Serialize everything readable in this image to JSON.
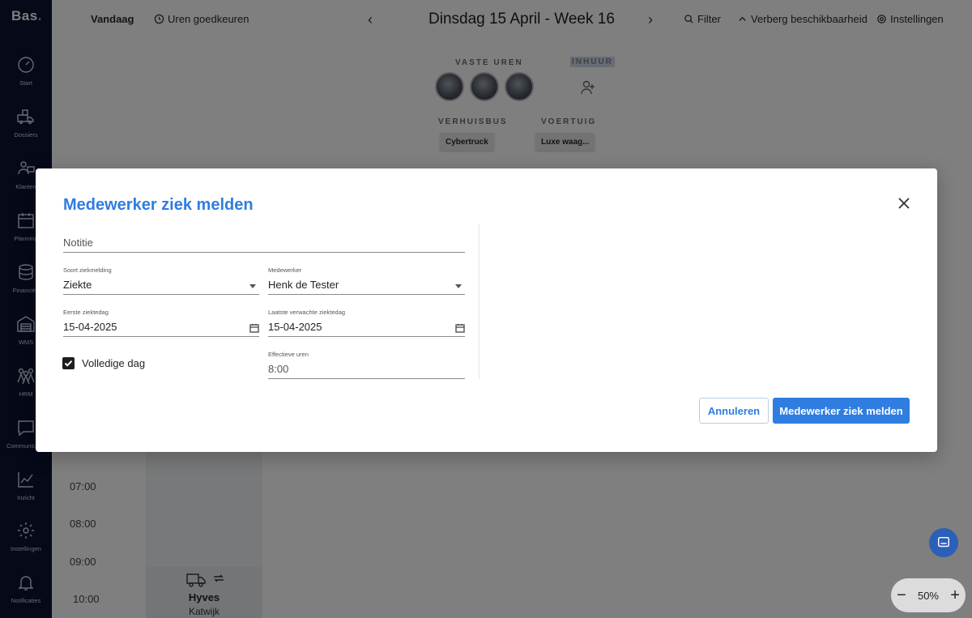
{
  "sidebar": {
    "logo": "Bas",
    "items": [
      {
        "label": "Start",
        "icon": "dashboard-icon"
      },
      {
        "label": "Dossiers",
        "icon": "truck-boxes-icon"
      },
      {
        "label": "Klanten",
        "icon": "customers-icon"
      },
      {
        "label": "Planning",
        "icon": "calendar-icon"
      },
      {
        "label": "Financiën",
        "icon": "coins-icon"
      },
      {
        "label": "WMS",
        "icon": "warehouse-icon"
      },
      {
        "label": "HRM",
        "icon": "people-icon"
      },
      {
        "label": "Communicatie",
        "icon": "chat-icon"
      },
      {
        "label": "Inzicht",
        "icon": "chart-icon"
      },
      {
        "label": "Instellingen",
        "icon": "gear-icon"
      },
      {
        "label": "Notificaties",
        "icon": "bell-icon"
      }
    ]
  },
  "topbar": {
    "today": "Vandaag",
    "approve_hours": "Uren goedkeuren",
    "date_title": "Dinsdag 15 April - Week 16",
    "filter": "Filter",
    "hide_availability": "Verberg beschikbaarheid",
    "settings": "Instellingen"
  },
  "planning": {
    "fixed_hours_label": "VASTE UREN",
    "hire_label": "INHUUR",
    "moving_van_label": "VERHUISBUS",
    "vehicle_label": "VOERTUIG",
    "moving_van_chip": "Cybertruck",
    "vehicle_chip": "Luxe waag...",
    "hours": [
      "07:00",
      "08:00",
      "09:00",
      "10:00"
    ],
    "card_title": "Hyves",
    "card_subtitle": "Katwijk"
  },
  "modal": {
    "title": "Medewerker ziek melden",
    "note_placeholder": "Notitie",
    "type_label": "Soort ziekmelding",
    "type_value": "Ziekte",
    "employee_label": "Medewerker",
    "employee_value": "Henk de Tester",
    "first_day_label": "Eerste ziektedag",
    "first_day_value": "15-04-2025",
    "last_day_label": "Laatste verwachte ziektedag",
    "last_day_value": "15-04-2025",
    "full_day_label": "Volledige dag",
    "full_day_checked": true,
    "effective_hours_label": "Effectieve uren",
    "effective_hours_value": "8:00",
    "cancel_label": "Annuleren",
    "submit_label": "Medewerker ziek melden"
  },
  "zoom": {
    "value": "50%"
  },
  "colors": {
    "accent": "#2f7de1",
    "sidebar": "#0a1330"
  }
}
